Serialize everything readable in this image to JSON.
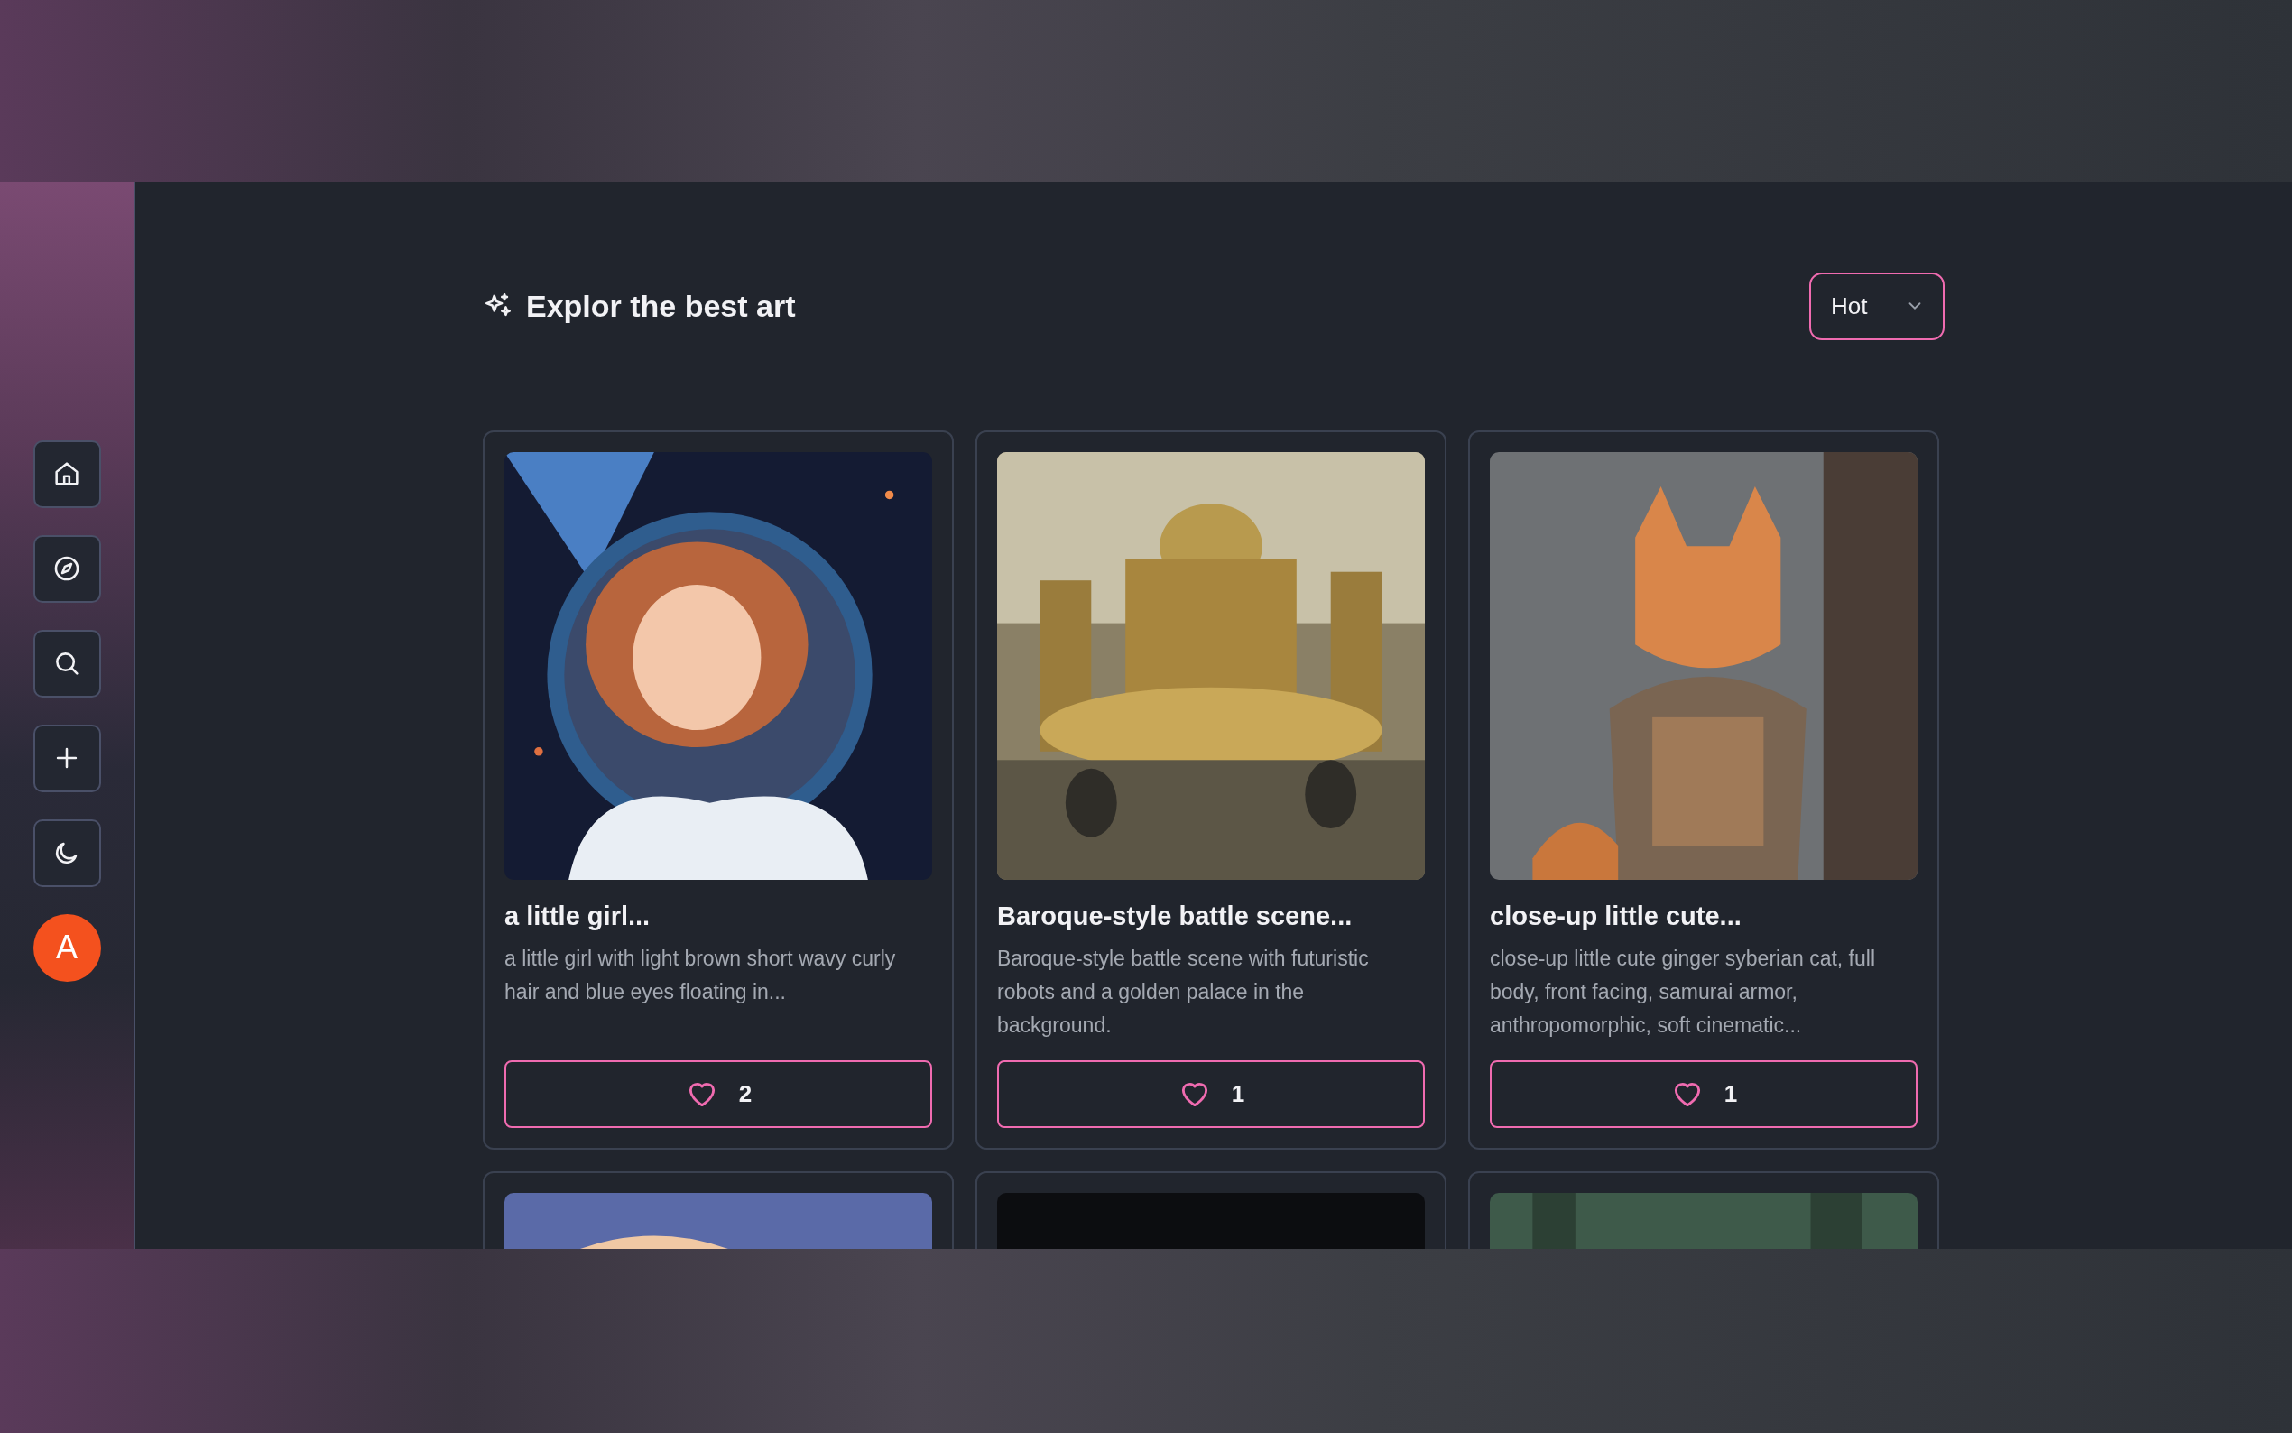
{
  "header": {
    "title": "Explor the best art"
  },
  "sort": {
    "value": "Hot"
  },
  "avatar": "A",
  "cards": [
    {
      "kind": "full",
      "title": "a little girl...",
      "description": "a little girl with light brown short wavy curly hair and blue eyes floating in...",
      "likes": "2"
    },
    {
      "kind": "full",
      "title": "Baroque-style battle scene...",
      "description": "Baroque-style battle scene with futuristic robots and a golden palace in the background.",
      "likes": "1"
    },
    {
      "kind": "full",
      "title": "close-up little cute...",
      "description": "close-up little cute ginger syberian cat, full body, front facing, samurai armor, anthropomorphic, soft cinematic...",
      "likes": "1"
    },
    {
      "kind": "cut"
    },
    {
      "kind": "cut"
    },
    {
      "kind": "cut"
    }
  ]
}
